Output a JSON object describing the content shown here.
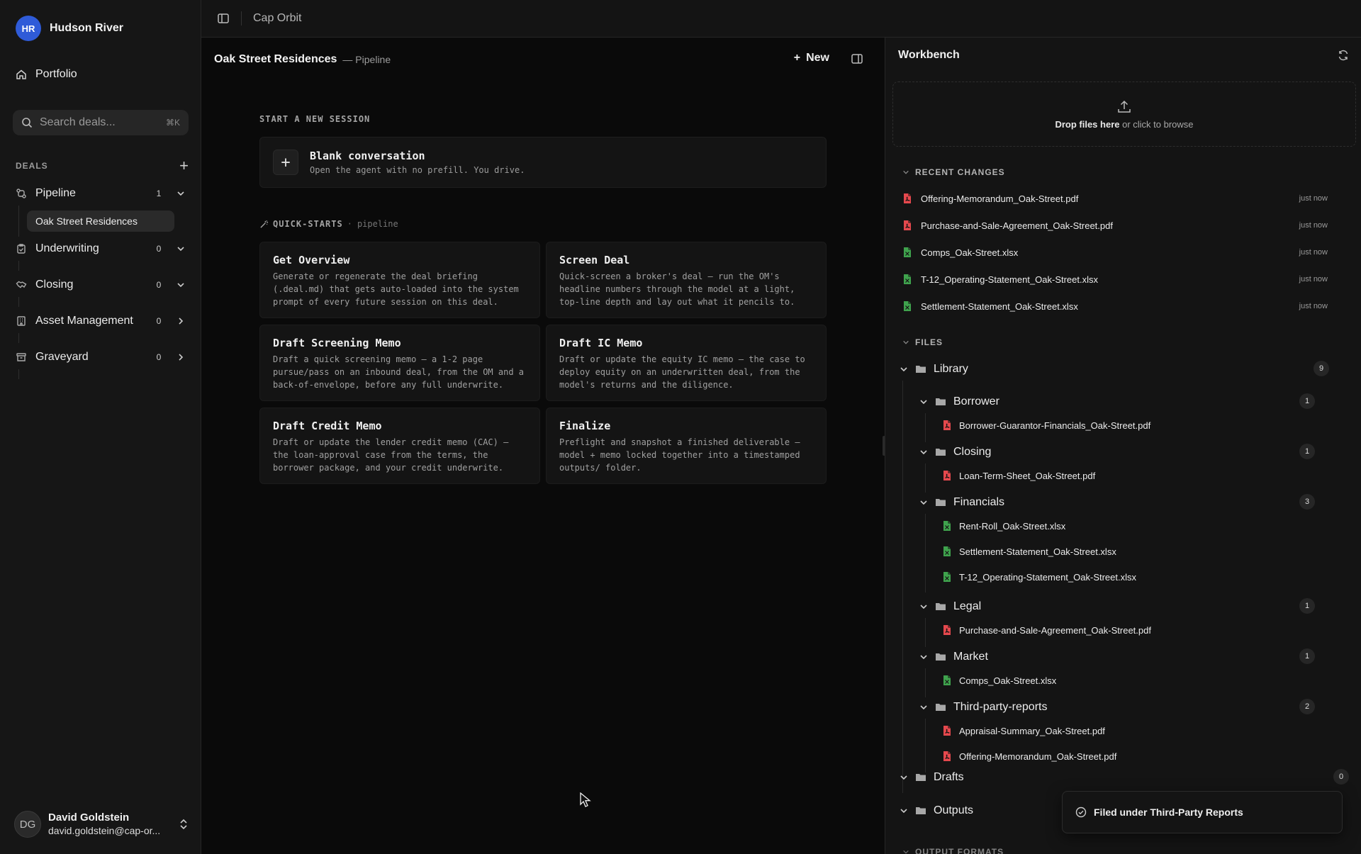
{
  "sidebar": {
    "org_initials": "HR",
    "org_name": "Hudson River",
    "portfolio_label": "Portfolio",
    "search_placeholder": "Search deals...",
    "search_shortcut": "⌘K",
    "deals_header": "DEALS",
    "stages": [
      {
        "label": "Pipeline",
        "count": "1",
        "icon": "pipeline-icon",
        "expanded": true
      },
      {
        "label": "Underwriting",
        "count": "0",
        "icon": "clipboard-check-icon",
        "expanded": true
      },
      {
        "label": "Closing",
        "count": "0",
        "icon": "handshake-icon",
        "expanded": true
      },
      {
        "label": "Asset Management",
        "count": "0",
        "icon": "building-icon",
        "expanded": false
      },
      {
        "label": "Graveyard",
        "count": "0",
        "icon": "archive-icon",
        "expanded": false
      }
    ],
    "pipeline_deal": "Oak Street Residences",
    "user": {
      "initials": "DG",
      "name": "David Goldstein",
      "email": "david.goldstein@cap-or..."
    }
  },
  "topbar": {
    "app_name": "Cap Orbit"
  },
  "center": {
    "title": "Oak Street Residences",
    "subtitle": "— Pipeline",
    "new_label": "New",
    "start_section": "START A NEW SESSION",
    "blank": {
      "title": "Blank conversation",
      "desc": "Open the agent with no prefill. You drive."
    },
    "quickstarts_label": "QUICK-STARTS",
    "quickstarts_sep": "·",
    "quickstarts_scope": "pipeline",
    "quickstarts": [
      {
        "title": "Get Overview",
        "desc": "Generate or regenerate the deal briefing (.deal.md) that gets auto-loaded into the system prompt of every future session on this deal."
      },
      {
        "title": "Screen Deal",
        "desc": "Quick-screen a broker's deal — run the OM's headline numbers through the model at a light, top-line depth and lay out what it pencils to."
      },
      {
        "title": "Draft Screening Memo",
        "desc": "Draft a quick screening memo — a 1-2 page pursue/pass on an inbound deal, from the OM and a back-of-envelope, before any full underwrite."
      },
      {
        "title": "Draft IC Memo",
        "desc": "Draft or update the equity IC memo — the case to deploy equity on an underwritten deal, from the model's returns and the diligence."
      },
      {
        "title": "Draft Credit Memo",
        "desc": "Draft or update the lender credit memo (CAC) — the loan-approval case from the terms, the borrower package, and your credit underwrite."
      },
      {
        "title": "Finalize",
        "desc": "Preflight and snapshot a finished deliverable — model + memo locked together into a timestamped outputs/ folder."
      }
    ]
  },
  "workbench": {
    "title": "Workbench",
    "drop_bold": "Drop files here",
    "drop_rest": "or click to browse",
    "recent_label": "RECENT CHANGES",
    "recent": [
      {
        "name": "Offering-Memorandum_Oak-Street.pdf",
        "type": "pdf",
        "time": "just now"
      },
      {
        "name": "Purchase-and-Sale-Agreement_Oak-Street.pdf",
        "type": "pdf",
        "time": "just now"
      },
      {
        "name": "Comps_Oak-Street.xlsx",
        "type": "xlsx",
        "time": "just now"
      },
      {
        "name": "T-12_Operating-Statement_Oak-Street.xlsx",
        "type": "xlsx",
        "time": "just now"
      },
      {
        "name": "Settlement-Statement_Oak-Street.xlsx",
        "type": "xlsx",
        "time": "just now"
      }
    ],
    "files_label": "FILES",
    "library": {
      "name": "Library",
      "count": "9"
    },
    "folders": [
      {
        "name": "Borrower",
        "count": "1",
        "files": [
          {
            "name": "Borrower-Guarantor-Financials_Oak-Street.pdf",
            "type": "pdf"
          }
        ]
      },
      {
        "name": "Closing",
        "count": "1",
        "files": [
          {
            "name": "Loan-Term-Sheet_Oak-Street.pdf",
            "type": "pdf"
          }
        ]
      },
      {
        "name": "Financials",
        "count": "3",
        "files": [
          {
            "name": "Rent-Roll_Oak-Street.xlsx",
            "type": "xlsx"
          },
          {
            "name": "Settlement-Statement_Oak-Street.xlsx",
            "type": "xlsx"
          },
          {
            "name": "T-12_Operating-Statement_Oak-Street.xlsx",
            "type": "xlsx"
          }
        ]
      },
      {
        "name": "Legal",
        "count": "1",
        "files": [
          {
            "name": "Purchase-and-Sale-Agreement_Oak-Street.pdf",
            "type": "pdf"
          }
        ]
      },
      {
        "name": "Market",
        "count": "1",
        "files": [
          {
            "name": "Comps_Oak-Street.xlsx",
            "type": "xlsx"
          }
        ]
      },
      {
        "name": "Third-party-reports",
        "count": "2",
        "files": [
          {
            "name": "Appraisal-Summary_Oak-Street.pdf",
            "type": "pdf"
          },
          {
            "name": "Offering-Memorandum_Oak-Street.pdf",
            "type": "pdf"
          }
        ]
      }
    ],
    "drafts": {
      "name": "Drafts",
      "count": "0"
    },
    "outputs": {
      "name": "Outputs"
    },
    "output_formats_label": "OUTPUT FORMATS"
  },
  "toast": {
    "message": "Filed under Third-Party Reports"
  },
  "colors": {
    "accent": "#2f5bd8",
    "pdf": "#e5484d",
    "xlsx": "#3fa34d"
  }
}
